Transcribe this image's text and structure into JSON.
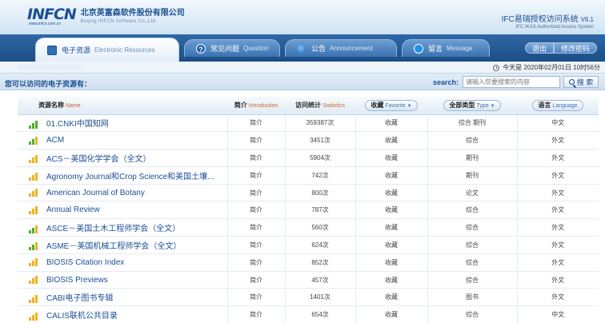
{
  "header": {
    "logo_word": "INFCN",
    "logo_url": "www.infcn.com.cn",
    "company_cn": "北京英富森软件股份有限公司",
    "company_en": "Beijing INFCN Software Co.,Ltd.",
    "system_cn": "IFC易瑞授权访问系统",
    "system_version": "V6.1",
    "system_en": "IFC IKAS Authorized Access System"
  },
  "nav": {
    "tabs": [
      {
        "label": "电子资源",
        "en": "Electronic Resources",
        "icon": "home-icon",
        "active": true
      },
      {
        "label": "常见问题",
        "en": "Question",
        "icon": "help-icon",
        "active": false
      },
      {
        "label": "公告",
        "en": "Announcement",
        "icon": "announcement-icon",
        "active": false
      },
      {
        "label": "留言",
        "en": "Message",
        "icon": "message-icon",
        "active": false
      }
    ],
    "logout": "退出",
    "change_password": "修改密码"
  },
  "info": {
    "date": "今天是 2020年02月01日 10时56分"
  },
  "search": {
    "available_label": "您可以访问的电子资源有：",
    "label": "search:",
    "placeholder": "请输入您要搜索的内容",
    "button": "搜 索"
  },
  "table": {
    "headers": {
      "name": "资源名称",
      "name_en": "Name",
      "intro": "简介",
      "intro_en": "Introduction",
      "stats": "访问统计",
      "stats_en": "Statistics",
      "favorite": "收藏",
      "favorite_en": "Favorite",
      "type": "全部类型",
      "type_en": "Type",
      "language": "语言",
      "language_en": "Language"
    },
    "rows": [
      {
        "name": "01.CNKI中国知网",
        "intro": "简介",
        "stats": "359387次",
        "favorite": "收藏",
        "type": "综合 期刊",
        "language": "中文",
        "signal": "green"
      },
      {
        "name": "ACM",
        "intro": "简介",
        "stats": "3451次",
        "favorite": "收藏",
        "type": "综合",
        "language": "外文",
        "signal": "mixed"
      },
      {
        "name": "ACS－美国化学学会（全文）",
        "intro": "简介",
        "stats": "5904次",
        "favorite": "收藏",
        "type": "期刊",
        "language": "外文",
        "signal": "yellow"
      },
      {
        "name": "Agronomy Journal和Crop Science和美国土壤...",
        "intro": "简介",
        "stats": "742次",
        "favorite": "收藏",
        "type": "期刊",
        "language": "外文",
        "signal": "yellow"
      },
      {
        "name": "American Journal of Botany",
        "intro": "简介",
        "stats": "800次",
        "favorite": "收藏",
        "type": "论文",
        "language": "外文",
        "signal": "yellow"
      },
      {
        "name": "Annual Review",
        "intro": "简介",
        "stats": "787次",
        "favorite": "收藏",
        "type": "综合",
        "language": "外文",
        "signal": "yellow"
      },
      {
        "name": "ASCE－美国土木工程师学会（全文）",
        "intro": "简介",
        "stats": "560次",
        "favorite": "收藏",
        "type": "综合",
        "language": "外文",
        "signal": "mixed"
      },
      {
        "name": "ASME－美国机械工程师学会（全文）",
        "intro": "简介",
        "stats": "624次",
        "favorite": "收藏",
        "type": "综合",
        "language": "外文",
        "signal": "mixed"
      },
      {
        "name": "BIOSIS Citation Index",
        "intro": "简介",
        "stats": "852次",
        "favorite": "收藏",
        "type": "综合",
        "language": "外文",
        "signal": "yellow"
      },
      {
        "name": "BIOSIS Previews",
        "intro": "简介",
        "stats": "457次",
        "favorite": "收藏",
        "type": "综合",
        "language": "外文",
        "signal": "yellow"
      },
      {
        "name": "CABI电子图书专辑",
        "intro": "简介",
        "stats": "1401次",
        "favorite": "收藏",
        "type": "图书",
        "language": "外文",
        "signal": "yellow"
      },
      {
        "name": "CALIS联机公共目录",
        "intro": "简介",
        "stats": "654次",
        "favorite": "收藏",
        "type": "综合",
        "language": "中文",
        "signal": "yellow"
      }
    ]
  },
  "colors": {
    "brand": "#1c4f94",
    "nav_bg": "#2f68a6",
    "signal_green": "#4caf2f",
    "signal_yellow": "#f0b221"
  }
}
